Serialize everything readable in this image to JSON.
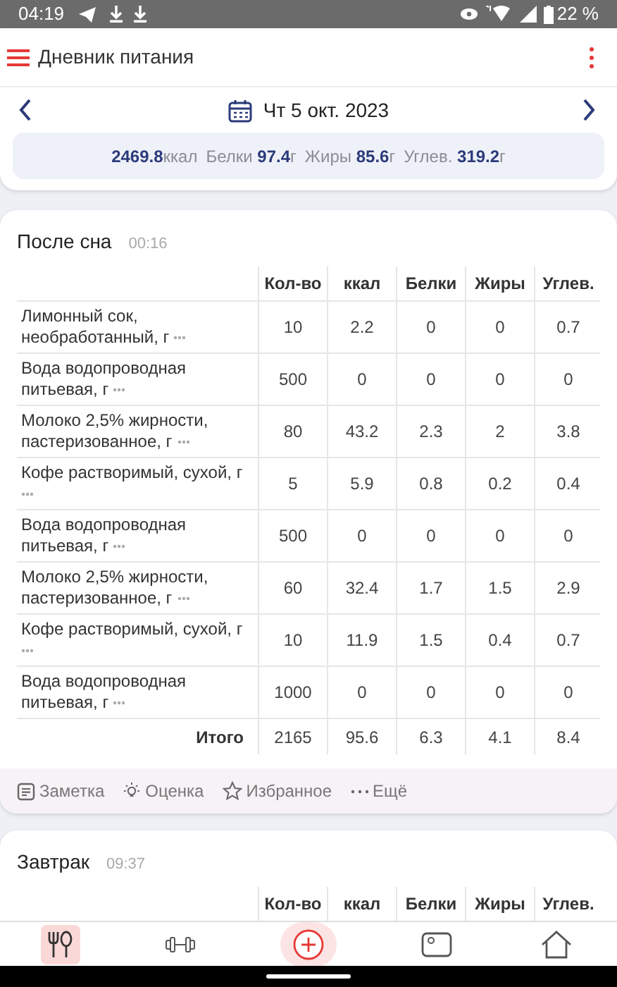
{
  "status_bar": {
    "time": "04:19",
    "battery": "22 %"
  },
  "app_bar": {
    "title": "Дневник питания"
  },
  "date_nav": {
    "date": "Чт 5 окт. 2023"
  },
  "summary": [
    {
      "value": "2469.8",
      "unit": "ккал"
    },
    {
      "label": "Белки",
      "value": "97.4",
      "unit": "г"
    },
    {
      "label": "Жиры",
      "value": "85.6",
      "unit": "г"
    },
    {
      "label": "Углев.",
      "value": "319.2",
      "unit": "г"
    }
  ],
  "meals": [
    {
      "title": "После сна",
      "time": "00:16",
      "columns": [
        "Кол-во",
        "ккал",
        "Белки",
        "Жиры",
        "Углев."
      ],
      "rows": [
        {
          "name": "Лимонный сок, необработанный, г",
          "values": [
            "10",
            "2.2",
            "0",
            "0",
            "0.7"
          ]
        },
        {
          "name": "Вода водопроводная питьевая, г",
          "values": [
            "500",
            "0",
            "0",
            "0",
            "0"
          ]
        },
        {
          "name": "Молоко 2,5% жирности, пастеризованное, г",
          "values": [
            "80",
            "43.2",
            "2.3",
            "2",
            "3.8"
          ]
        },
        {
          "name": "Кофе растворимый, сухой, г",
          "values": [
            "5",
            "5.9",
            "0.8",
            "0.2",
            "0.4"
          ]
        },
        {
          "name": "Вода водопроводная питьевая, г",
          "values": [
            "500",
            "0",
            "0",
            "0",
            "0"
          ]
        },
        {
          "name": "Молоко 2,5% жирности, пастеризованное, г",
          "values": [
            "60",
            "32.4",
            "1.7",
            "1.5",
            "2.9"
          ]
        },
        {
          "name": "Кофе растворимый, сухой, г",
          "values": [
            "10",
            "11.9",
            "1.5",
            "0.4",
            "0.7"
          ]
        },
        {
          "name": "Вода водопроводная питьевая, г",
          "values": [
            "1000",
            "0",
            "0",
            "0",
            "0"
          ]
        }
      ],
      "total": {
        "label": "Итого",
        "values": [
          "2165",
          "95.6",
          "6.3",
          "4.1",
          "8.4"
        ]
      },
      "actions": [
        {
          "kind": "note",
          "label": "Заметка"
        },
        {
          "kind": "rating",
          "label": "Оценка"
        },
        {
          "kind": "favorite",
          "label": "Избранное"
        },
        {
          "kind": "more",
          "label": "Ещё"
        }
      ]
    },
    {
      "title": "Завтрак",
      "time": "09:37",
      "columns": [
        "Кол-во",
        "ккал",
        "Белки",
        "Жиры",
        "Углев."
      ]
    }
  ],
  "bottom_nav": [
    {
      "kind": "food",
      "selected": true
    },
    {
      "kind": "exercise",
      "selected": false
    },
    {
      "kind": "add",
      "selected": false
    },
    {
      "kind": "photo",
      "selected": false
    },
    {
      "kind": "home",
      "selected": false
    }
  ]
}
